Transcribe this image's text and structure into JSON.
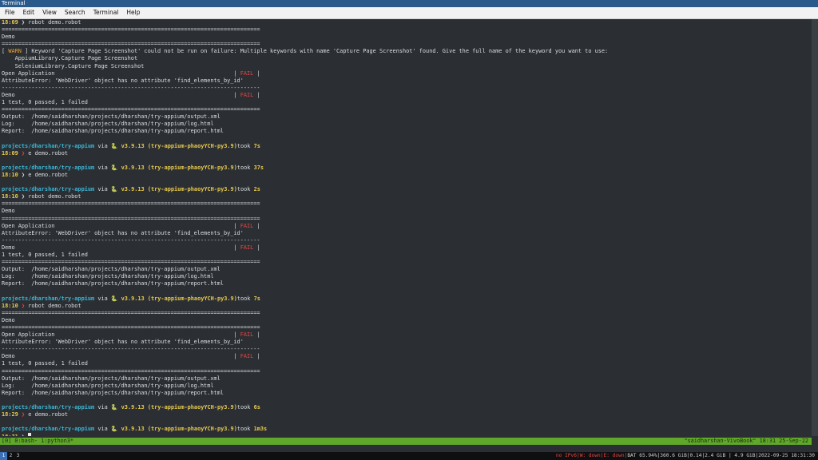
{
  "window": {
    "title": "Terminal"
  },
  "menu": [
    "File",
    "Edit",
    "View",
    "Search",
    "Terminal",
    "Help"
  ],
  "terminal": {
    "lines": [
      [
        {
          "t": "18:09 ",
          "c": "yellow"
        },
        {
          "t": "❯ robot demo.robot",
          "c": ""
        }
      ],
      [
        {
          "t": "==============================================================================",
          "c": ""
        }
      ],
      [
        {
          "t": "Demo",
          "c": ""
        }
      ],
      [
        {
          "t": "==============================================================================",
          "c": ""
        }
      ],
      [
        {
          "t": "[ ",
          "c": ""
        },
        {
          "t": "WARN",
          "c": "orange"
        },
        {
          "t": " ] Keyword 'Capture Page Screenshot' could not be run on failure: Multiple keywords with name 'Capture Page Screenshot' found. Give the full name of the keyword you want to use:",
          "c": ""
        }
      ],
      [
        {
          "t": "    AppiumLibrary.Capture Page Screenshot",
          "c": ""
        }
      ],
      [
        {
          "t": "    SeleniumLibrary.Capture Page Screenshot",
          "c": ""
        }
      ],
      [
        {
          "t": "Open Application                                                      | ",
          "c": ""
        },
        {
          "t": "FAIL",
          "c": "red"
        },
        {
          "t": " |",
          "c": ""
        }
      ],
      [
        {
          "t": "AttributeError: 'WebDriver' object has no attribute 'find_elements_by_id'",
          "c": ""
        }
      ],
      [
        {
          "t": "------------------------------------------------------------------------------",
          "c": ""
        }
      ],
      [
        {
          "t": "Demo                                                                  | ",
          "c": ""
        },
        {
          "t": "FAIL",
          "c": "red"
        },
        {
          "t": " |",
          "c": ""
        }
      ],
      [
        {
          "t": "1 test, 0 passed, 1 failed",
          "c": ""
        }
      ],
      [
        {
          "t": "==============================================================================",
          "c": ""
        }
      ],
      [
        {
          "t": "Output:  /home/saidharshan/projects/dharshan/try-appium/output.xml",
          "c": ""
        }
      ],
      [
        {
          "t": "Log:     /home/saidharshan/projects/dharshan/try-appium/log.html",
          "c": ""
        }
      ],
      [
        {
          "t": "Report:  /home/saidharshan/projects/dharshan/try-appium/report.html",
          "c": ""
        }
      ],
      [
        {
          "t": "",
          "c": ""
        }
      ],
      [
        {
          "t": "projects/dharshan/try-appium",
          "c": "cyan"
        },
        {
          "t": " via ",
          "c": ""
        },
        {
          "t": "🐍 v3.9.13 (try-appium-phaoyYCH-py3.9)",
          "c": "yellow"
        },
        {
          "t": "took ",
          "c": ""
        },
        {
          "t": "7s",
          "c": "yellow"
        }
      ],
      [
        {
          "t": "18:09 ",
          "c": "yellow"
        },
        {
          "t": "❯ ",
          "c": "red"
        },
        {
          "t": "e demo.robot",
          "c": ""
        }
      ],
      [
        {
          "t": "",
          "c": ""
        }
      ],
      [
        {
          "t": "projects/dharshan/try-appium",
          "c": "cyan"
        },
        {
          "t": " via ",
          "c": ""
        },
        {
          "t": "🐍 v3.9.13 (try-appium-phaoyYCH-py3.9)",
          "c": "yellow"
        },
        {
          "t": "took ",
          "c": ""
        },
        {
          "t": "37s",
          "c": "yellow"
        }
      ],
      [
        {
          "t": "18:10 ",
          "c": "yellow"
        },
        {
          "t": "❯ e demo.robot",
          "c": ""
        }
      ],
      [
        {
          "t": "",
          "c": ""
        }
      ],
      [
        {
          "t": "projects/dharshan/try-appium",
          "c": "cyan"
        },
        {
          "t": " via ",
          "c": ""
        },
        {
          "t": "🐍 v3.9.13 (try-appium-phaoyYCH-py3.9)",
          "c": "yellow"
        },
        {
          "t": "took ",
          "c": ""
        },
        {
          "t": "2s",
          "c": "yellow"
        }
      ],
      [
        {
          "t": "18:10 ",
          "c": "yellow"
        },
        {
          "t": "❯ robot demo.robot",
          "c": ""
        }
      ],
      [
        {
          "t": "==============================================================================",
          "c": ""
        }
      ],
      [
        {
          "t": "Demo",
          "c": ""
        }
      ],
      [
        {
          "t": "==============================================================================",
          "c": ""
        }
      ],
      [
        {
          "t": "Open Application                                                      | ",
          "c": ""
        },
        {
          "t": "FAIL",
          "c": "red"
        },
        {
          "t": " |",
          "c": ""
        }
      ],
      [
        {
          "t": "AttributeError: 'WebDriver' object has no attribute 'find_elements_by_id'",
          "c": ""
        }
      ],
      [
        {
          "t": "------------------------------------------------------------------------------",
          "c": ""
        }
      ],
      [
        {
          "t": "Demo                                                                  | ",
          "c": ""
        },
        {
          "t": "FAIL",
          "c": "red"
        },
        {
          "t": " |",
          "c": ""
        }
      ],
      [
        {
          "t": "1 test, 0 passed, 1 failed",
          "c": ""
        }
      ],
      [
        {
          "t": "==============================================================================",
          "c": ""
        }
      ],
      [
        {
          "t": "Output:  /home/saidharshan/projects/dharshan/try-appium/output.xml",
          "c": ""
        }
      ],
      [
        {
          "t": "Log:     /home/saidharshan/projects/dharshan/try-appium/log.html",
          "c": ""
        }
      ],
      [
        {
          "t": "Report:  /home/saidharshan/projects/dharshan/try-appium/report.html",
          "c": ""
        }
      ],
      [
        {
          "t": "",
          "c": ""
        }
      ],
      [
        {
          "t": "projects/dharshan/try-appium",
          "c": "cyan"
        },
        {
          "t": " via ",
          "c": ""
        },
        {
          "t": "🐍 v3.9.13 (try-appium-phaoyYCH-py3.9)",
          "c": "yellow"
        },
        {
          "t": "took ",
          "c": ""
        },
        {
          "t": "7s",
          "c": "yellow"
        }
      ],
      [
        {
          "t": "18:10 ",
          "c": "yellow"
        },
        {
          "t": "❯ ",
          "c": "red"
        },
        {
          "t": "robot demo.robot",
          "c": ""
        }
      ],
      [
        {
          "t": "==============================================================================",
          "c": ""
        }
      ],
      [
        {
          "t": "Demo",
          "c": ""
        }
      ],
      [
        {
          "t": "==============================================================================",
          "c": ""
        }
      ],
      [
        {
          "t": "Open Application                                                      | ",
          "c": ""
        },
        {
          "t": "FAIL",
          "c": "red"
        },
        {
          "t": " |",
          "c": ""
        }
      ],
      [
        {
          "t": "AttributeError: 'WebDriver' object has no attribute 'find_elements_by_id'",
          "c": ""
        }
      ],
      [
        {
          "t": "------------------------------------------------------------------------------",
          "c": ""
        }
      ],
      [
        {
          "t": "Demo                                                                  | ",
          "c": ""
        },
        {
          "t": "FAIL",
          "c": "red"
        },
        {
          "t": " |",
          "c": ""
        }
      ],
      [
        {
          "t": "1 test, 0 passed, 1 failed",
          "c": ""
        }
      ],
      [
        {
          "t": "==============================================================================",
          "c": ""
        }
      ],
      [
        {
          "t": "Output:  /home/saidharshan/projects/dharshan/try-appium/output.xml",
          "c": ""
        }
      ],
      [
        {
          "t": "Log:     /home/saidharshan/projects/dharshan/try-appium/log.html",
          "c": ""
        }
      ],
      [
        {
          "t": "Report:  /home/saidharshan/projects/dharshan/try-appium/report.html",
          "c": ""
        }
      ],
      [
        {
          "t": "",
          "c": ""
        }
      ],
      [
        {
          "t": "projects/dharshan/try-appium",
          "c": "cyan"
        },
        {
          "t": " via ",
          "c": ""
        },
        {
          "t": "🐍 v3.9.13 (try-appium-phaoyYCH-py3.9)",
          "c": "yellow"
        },
        {
          "t": "took ",
          "c": ""
        },
        {
          "t": "6s",
          "c": "yellow"
        }
      ],
      [
        {
          "t": "18:29 ",
          "c": "yellow"
        },
        {
          "t": "❯ ",
          "c": "red"
        },
        {
          "t": "e demo.robot",
          "c": ""
        }
      ],
      [
        {
          "t": "",
          "c": ""
        }
      ],
      [
        {
          "t": "projects/dharshan/try-appium",
          "c": "cyan"
        },
        {
          "t": " via ",
          "c": ""
        },
        {
          "t": "🐍 v3.9.13 (try-appium-phaoyYCH-py3.9)",
          "c": "yellow"
        },
        {
          "t": "took ",
          "c": ""
        },
        {
          "t": "1m3s",
          "c": "yellow"
        }
      ],
      [
        {
          "t": "18:31 ",
          "c": "yellow"
        },
        {
          "t": "❯ ",
          "c": ""
        }
      ]
    ]
  },
  "tmux": {
    "left": "[0] 0:bash- 1:python3*",
    "right": "\"saidharshan-VivoBook\" 18:31 25-Sep-22"
  },
  "panel": {
    "workspaces": [
      "1",
      "2",
      "3"
    ],
    "active_workspace": "1",
    "status_bad": "no IPv6|W: down|E: down|",
    "status_rest": "BAT 65.94%|360.6 GiB|0.14|2.4 GiB | 4.9 GiB|2022-09-25 18:31:30"
  },
  "colors": {
    "background": "#2b2f33",
    "cyan": "#3cb4d4",
    "yellow": "#e8c94c",
    "red": "#e64545",
    "tmux_green": "#5fa82a"
  }
}
